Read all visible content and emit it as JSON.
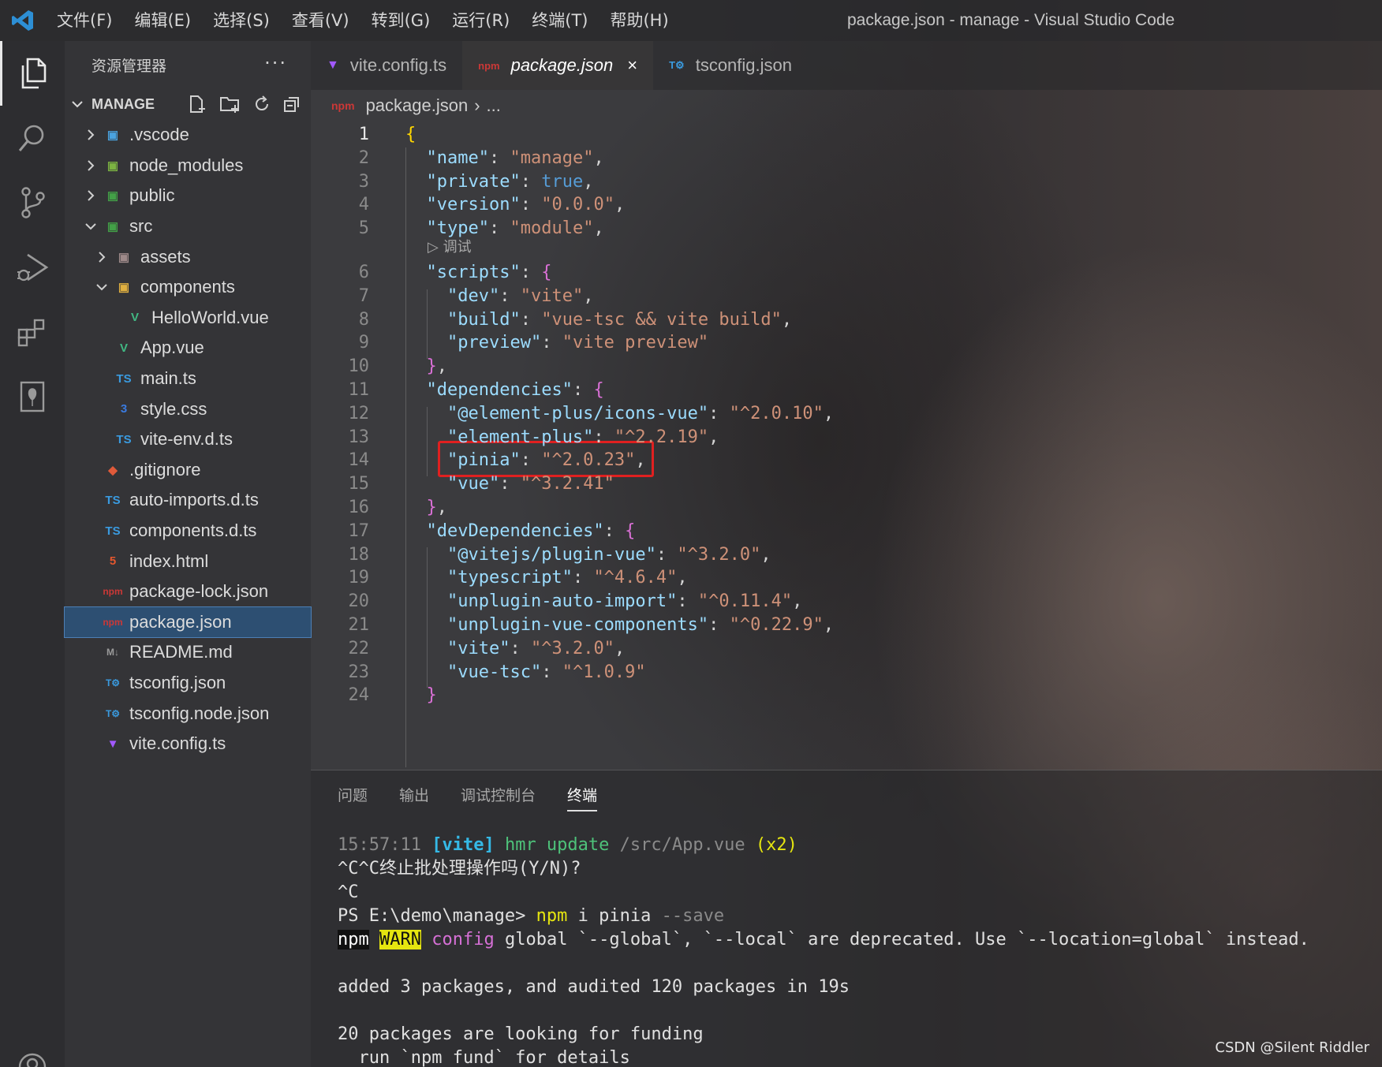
{
  "window": {
    "title": "package.json - manage - Visual Studio Code",
    "menu": [
      "文件(F)",
      "编辑(E)",
      "选择(S)",
      "查看(V)",
      "转到(G)",
      "运行(R)",
      "终端(T)",
      "帮助(H)"
    ]
  },
  "sidebar": {
    "title": "资源管理器",
    "more": "···",
    "section": "MANAGE",
    "tree": [
      {
        "label": ".vscode",
        "icon": "vscode-folder-icon",
        "chev": "›",
        "indent": 0
      },
      {
        "label": "node_modules",
        "icon": "node-folder-icon",
        "chev": "›",
        "indent": 0
      },
      {
        "label": "public",
        "icon": "public-folder-icon",
        "chev": "›",
        "indent": 0
      },
      {
        "label": "src",
        "icon": "src-folder-icon",
        "chev": "⌄",
        "indent": 0
      },
      {
        "label": "assets",
        "icon": "assets-folder-icon",
        "chev": "›",
        "indent": 1
      },
      {
        "label": "components",
        "icon": "components-folder-icon",
        "chev": "⌄",
        "indent": 1
      },
      {
        "label": "HelloWorld.vue",
        "icon": "vue-icon",
        "chev": "",
        "indent": 2
      },
      {
        "label": "App.vue",
        "icon": "vue-icon",
        "chev": "",
        "indent": 1
      },
      {
        "label": "main.ts",
        "icon": "ts-icon",
        "chev": "",
        "indent": 1
      },
      {
        "label": "style.css",
        "icon": "css-icon",
        "chev": "",
        "indent": 1
      },
      {
        "label": "vite-env.d.ts",
        "icon": "ts-icon",
        "chev": "",
        "indent": 1
      },
      {
        "label": ".gitignore",
        "icon": "git-icon",
        "chev": "",
        "indent": 0
      },
      {
        "label": "auto-imports.d.ts",
        "icon": "ts-icon",
        "chev": "",
        "indent": 0
      },
      {
        "label": "components.d.ts",
        "icon": "ts-icon",
        "chev": "",
        "indent": 0
      },
      {
        "label": "index.html",
        "icon": "html-icon",
        "chev": "",
        "indent": 0
      },
      {
        "label": "package-lock.json",
        "icon": "npm-icon",
        "chev": "",
        "indent": 0
      },
      {
        "label": "package.json",
        "icon": "npm-icon",
        "chev": "",
        "indent": 0,
        "selected": true
      },
      {
        "label": "README.md",
        "icon": "markdown-icon",
        "chev": "",
        "indent": 0
      },
      {
        "label": "tsconfig.json",
        "icon": "tsconfig-icon",
        "chev": "",
        "indent": 0
      },
      {
        "label": "tsconfig.node.json",
        "icon": "tsconfig-icon",
        "chev": "",
        "indent": 0
      },
      {
        "label": "vite.config.ts",
        "icon": "vite-icon",
        "chev": "",
        "indent": 0
      }
    ]
  },
  "tabs": [
    {
      "label": "vite.config.ts",
      "icon": "vite-icon",
      "active": false
    },
    {
      "label": "package.json",
      "icon": "npm-icon",
      "active": true,
      "close": "×"
    },
    {
      "label": "tsconfig.json",
      "icon": "tsconfig-icon",
      "active": false
    }
  ],
  "breadcrumb": {
    "file": "package.json",
    "sep": "›",
    "rest": "..."
  },
  "editor": {
    "codelens": "▷ 调试",
    "lines": [
      {
        "n": "1",
        "parts": [
          [
            "br1",
            "{"
          ]
        ]
      },
      {
        "n": "2",
        "parts": [
          [
            "p",
            "  "
          ],
          [
            "k",
            "\"name\""
          ],
          [
            "p",
            ": "
          ],
          [
            "s",
            "\"manage\""
          ],
          [
            "p",
            ","
          ]
        ]
      },
      {
        "n": "3",
        "parts": [
          [
            "p",
            "  "
          ],
          [
            "k",
            "\"private\""
          ],
          [
            "p",
            ": "
          ],
          [
            "b",
            "true"
          ],
          [
            "p",
            ","
          ]
        ]
      },
      {
        "n": "4",
        "parts": [
          [
            "p",
            "  "
          ],
          [
            "k",
            "\"version\""
          ],
          [
            "p",
            ": "
          ],
          [
            "s",
            "\"0.0.0\""
          ],
          [
            "p",
            ","
          ]
        ]
      },
      {
        "n": "5",
        "parts": [
          [
            "p",
            "  "
          ],
          [
            "k",
            "\"type\""
          ],
          [
            "p",
            ": "
          ],
          [
            "s",
            "\"module\""
          ],
          [
            "p",
            ","
          ]
        ]
      },
      {
        "n": "6",
        "parts": [
          [
            "p",
            "  "
          ],
          [
            "k",
            "\"scripts\""
          ],
          [
            "p",
            ": "
          ],
          [
            "br2",
            "{"
          ]
        ]
      },
      {
        "n": "7",
        "parts": [
          [
            "p",
            "    "
          ],
          [
            "k",
            "\"dev\""
          ],
          [
            "p",
            ": "
          ],
          [
            "s",
            "\"vite\""
          ],
          [
            "p",
            ","
          ]
        ]
      },
      {
        "n": "8",
        "parts": [
          [
            "p",
            "    "
          ],
          [
            "k",
            "\"build\""
          ],
          [
            "p",
            ": "
          ],
          [
            "s",
            "\"vue-tsc && vite build\""
          ],
          [
            "p",
            ","
          ]
        ]
      },
      {
        "n": "9",
        "parts": [
          [
            "p",
            "    "
          ],
          [
            "k",
            "\"preview\""
          ],
          [
            "p",
            ": "
          ],
          [
            "s",
            "\"vite preview\""
          ]
        ]
      },
      {
        "n": "10",
        "parts": [
          [
            "p",
            "  "
          ],
          [
            "br2",
            "}"
          ],
          [
            "p",
            ","
          ]
        ]
      },
      {
        "n": "11",
        "parts": [
          [
            "p",
            "  "
          ],
          [
            "k",
            "\"dependencies\""
          ],
          [
            "p",
            ": "
          ],
          [
            "br2",
            "{"
          ]
        ]
      },
      {
        "n": "12",
        "parts": [
          [
            "p",
            "    "
          ],
          [
            "k",
            "\"@element-plus/icons-vue\""
          ],
          [
            "p",
            ": "
          ],
          [
            "s",
            "\"^2.0.10\""
          ],
          [
            "p",
            ","
          ]
        ]
      },
      {
        "n": "13",
        "parts": [
          [
            "p",
            "    "
          ],
          [
            "k",
            "\"element-plus\""
          ],
          [
            "p",
            ": "
          ],
          [
            "s",
            "\"^2.2.19\""
          ],
          [
            "p",
            ","
          ]
        ]
      },
      {
        "n": "14",
        "parts": [
          [
            "p",
            "    "
          ],
          [
            "k",
            "\"pinia\""
          ],
          [
            "p",
            ": "
          ],
          [
            "s",
            "\"^2.0.23\""
          ],
          [
            "p",
            ","
          ]
        ]
      },
      {
        "n": "15",
        "parts": [
          [
            "p",
            "    "
          ],
          [
            "k",
            "\"vue\""
          ],
          [
            "p",
            ": "
          ],
          [
            "s",
            "\"^3.2.41\""
          ]
        ]
      },
      {
        "n": "16",
        "parts": [
          [
            "p",
            "  "
          ],
          [
            "br2",
            "}"
          ],
          [
            "p",
            ","
          ]
        ]
      },
      {
        "n": "17",
        "parts": [
          [
            "p",
            "  "
          ],
          [
            "k",
            "\"devDependencies\""
          ],
          [
            "p",
            ": "
          ],
          [
            "br2",
            "{"
          ]
        ]
      },
      {
        "n": "18",
        "parts": [
          [
            "p",
            "    "
          ],
          [
            "k",
            "\"@vitejs/plugin-vue\""
          ],
          [
            "p",
            ": "
          ],
          [
            "s",
            "\"^3.2.0\""
          ],
          [
            "p",
            ","
          ]
        ]
      },
      {
        "n": "19",
        "parts": [
          [
            "p",
            "    "
          ],
          [
            "k",
            "\"typescript\""
          ],
          [
            "p",
            ": "
          ],
          [
            "s",
            "\"^4.6.4\""
          ],
          [
            "p",
            ","
          ]
        ]
      },
      {
        "n": "20",
        "parts": [
          [
            "p",
            "    "
          ],
          [
            "k",
            "\"unplugin-auto-import\""
          ],
          [
            "p",
            ": "
          ],
          [
            "s",
            "\"^0.11.4\""
          ],
          [
            "p",
            ","
          ]
        ]
      },
      {
        "n": "21",
        "parts": [
          [
            "p",
            "    "
          ],
          [
            "k",
            "\"unplugin-vue-components\""
          ],
          [
            "p",
            ": "
          ],
          [
            "s",
            "\"^0.22.9\""
          ],
          [
            "p",
            ","
          ]
        ]
      },
      {
        "n": "22",
        "parts": [
          [
            "p",
            "    "
          ],
          [
            "k",
            "\"vite\""
          ],
          [
            "p",
            ": "
          ],
          [
            "s",
            "\"^3.2.0\""
          ],
          [
            "p",
            ","
          ]
        ]
      },
      {
        "n": "23",
        "parts": [
          [
            "p",
            "    "
          ],
          [
            "k",
            "\"vue-tsc\""
          ],
          [
            "p",
            ": "
          ],
          [
            "s",
            "\"^1.0.9\""
          ]
        ]
      },
      {
        "n": "24",
        "parts": [
          [
            "p",
            "  "
          ],
          [
            "br2",
            "}"
          ]
        ]
      }
    ]
  },
  "panel": {
    "tabs": [
      "问题",
      "输出",
      "调试控制台",
      "终端"
    ],
    "active_tab": "终端",
    "terminal": [
      [
        [
          "dim",
          "15:57:11 "
        ],
        [
          "cyanb",
          "[vite]"
        ],
        [
          "green",
          " hmr update "
        ],
        [
          "dim",
          "/src/App.vue "
        ],
        [
          "yellow",
          "(x2)"
        ]
      ],
      [
        [
          "",
          "^C^C终止批处理操作吗(Y/N)?"
        ]
      ],
      [
        [
          "",
          "^C"
        ]
      ],
      [
        [
          "",
          "PS E:\\demo\\manage> "
        ],
        [
          "yellow",
          "npm"
        ],
        [
          "",
          " i pinia "
        ],
        [
          "dim",
          "--save"
        ]
      ],
      [
        [
          "npm-badge",
          "npm"
        ],
        [
          "",
          " "
        ],
        [
          "warn-badge",
          "WARN"
        ],
        [
          "",
          " "
        ],
        [
          "magenta",
          "config"
        ],
        [
          "",
          " global `--global`, `--local` are deprecated. Use `--location=global` instead."
        ]
      ],
      [
        [
          "",
          ""
        ]
      ],
      [
        [
          "",
          "added 3 packages, and audited 120 packages in 19s"
        ]
      ],
      [
        [
          "",
          ""
        ]
      ],
      [
        [
          "",
          "20 packages are looking for funding"
        ]
      ],
      [
        [
          "",
          "  run `npm fund` for details"
        ]
      ]
    ]
  },
  "watermark": "CSDN @Silent Riddler"
}
